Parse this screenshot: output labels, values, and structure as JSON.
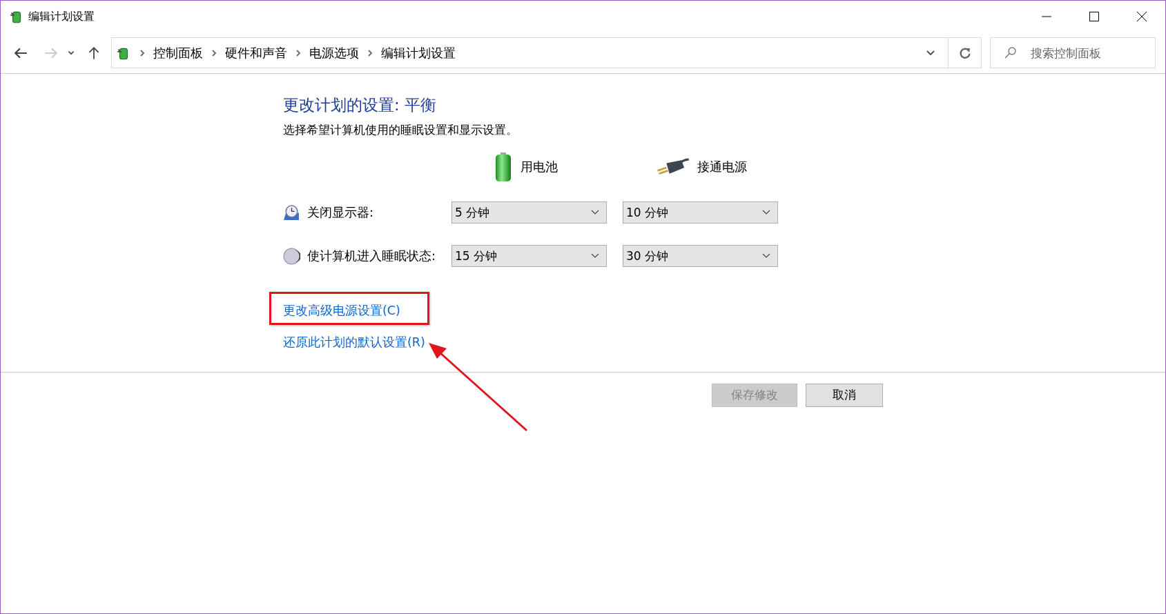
{
  "window": {
    "title": "编辑计划设置"
  },
  "address_bar": {
    "breadcrumbs": [
      "控制面板",
      "硬件和声音",
      "电源选项",
      "编辑计划设置"
    ]
  },
  "search": {
    "placeholder": "搜索控制面板"
  },
  "heading": "更改计划的设置: 平衡",
  "description": "选择希望计算机使用的睡眠设置和显示设置。",
  "columns": [
    {
      "kind": "battery",
      "label": "用电池"
    },
    {
      "kind": "plug",
      "label": "接通电源"
    }
  ],
  "settings": [
    {
      "kind": "display",
      "label": "关闭显示器:",
      "values": [
        "5 分钟",
        "10 分钟"
      ]
    },
    {
      "kind": "sleep",
      "label": "使计算机进入睡眠状态:",
      "values": [
        "15 分钟",
        "30 分钟"
      ]
    }
  ],
  "links": [
    {
      "label": "更改高级电源设置(C)",
      "highlighted": true
    },
    {
      "label": "还原此计划的默认设置(R)",
      "highlighted": false
    }
  ],
  "buttons": [
    {
      "label": "保存修改",
      "disabled": true
    },
    {
      "label": "取消",
      "disabled": false
    }
  ]
}
